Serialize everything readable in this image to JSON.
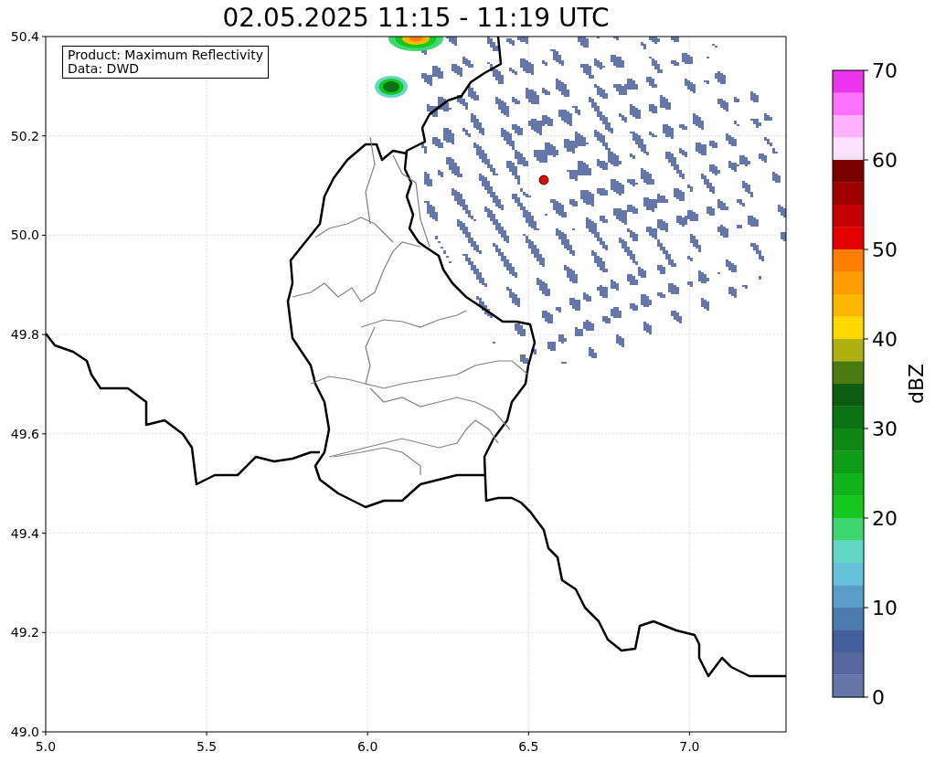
{
  "title": "02.05.2025 11:15 - 11:19 UTC",
  "legend": [
    "Product: Maximum Reflectivity",
    "Data: DWD"
  ],
  "map": {
    "y_ticks": [
      "50.4",
      "50.2",
      "50.0",
      "49.8",
      "49.6",
      "49.4",
      "49.2",
      "49.0"
    ],
    "x_ticks": [
      "5.0",
      "5.5",
      "6.0",
      "6.5",
      "7.0"
    ]
  },
  "colorbar": {
    "label": "dBZ",
    "ticks": [
      "70",
      "60",
      "50",
      "40",
      "30",
      "20",
      "10",
      "0"
    ],
    "segments": [
      {
        "color": "#ee33ee"
      },
      {
        "color": "#ff70ff"
      },
      {
        "color": "#ffb0ff"
      },
      {
        "color": "#ffe0ff"
      },
      {
        "color": "#7a0000"
      },
      {
        "color": "#a00000"
      },
      {
        "color": "#c40000"
      },
      {
        "color": "#e40000"
      },
      {
        "color": "#ff7e00"
      },
      {
        "color": "#ff9c00"
      },
      {
        "color": "#ffb800"
      },
      {
        "color": "#ffd800"
      },
      {
        "color": "#b0b010"
      },
      {
        "color": "#4a7a10"
      },
      {
        "color": "#0a5c0e"
      },
      {
        "color": "#0b7212"
      },
      {
        "color": "#0d8612"
      },
      {
        "color": "#0e9c16"
      },
      {
        "color": "#10b41a"
      },
      {
        "color": "#14c81e"
      },
      {
        "color": "#3fd870"
      },
      {
        "color": "#63d8c8"
      },
      {
        "color": "#65c0dd"
      },
      {
        "color": "#5a9dc8"
      },
      {
        "color": "#4a7ab0"
      },
      {
        "color": "#435f9f"
      },
      {
        "color": "#56689f"
      },
      {
        "color": "#6577a8"
      }
    ]
  }
}
